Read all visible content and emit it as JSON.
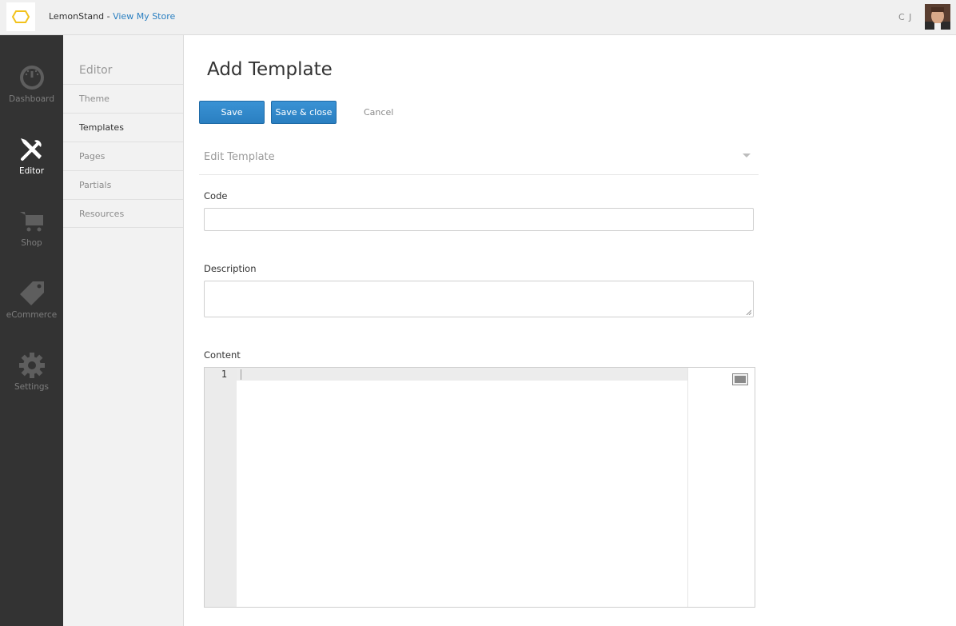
{
  "topbar": {
    "brand_name": "LemonStand",
    "separator": " - ",
    "view_store_label": "View My Store",
    "user_initials": "C J"
  },
  "mainnav": {
    "items": [
      {
        "label": "Dashboard",
        "icon": "dashboard-gauge-icon"
      },
      {
        "label": "Editor",
        "icon": "editor-tools-icon"
      },
      {
        "label": "Shop",
        "icon": "cart-icon"
      },
      {
        "label": "eCommerce",
        "icon": "tag-icon"
      },
      {
        "label": "Settings",
        "icon": "gear-icon"
      }
    ],
    "active": "Editor"
  },
  "subnav": {
    "title": "Editor",
    "items": [
      {
        "label": "Theme"
      },
      {
        "label": "Templates"
      },
      {
        "label": "Pages"
      },
      {
        "label": "Partials"
      },
      {
        "label": "Resources"
      }
    ],
    "active": "Templates"
  },
  "main": {
    "title": "Add Template",
    "save_label": "Save",
    "save_close_label": "Save & close",
    "cancel_label": "Cancel",
    "section_title": "Edit Template",
    "fields": {
      "code_label": "Code",
      "code_value": "",
      "description_label": "Description",
      "description_value": "",
      "content_label": "Content"
    },
    "editor": {
      "line_numbers": [
        "1"
      ]
    }
  },
  "colors": {
    "accent": "#2a7fc1",
    "nav_bg": "#333333",
    "logo_yellow": "#f2c21b"
  }
}
